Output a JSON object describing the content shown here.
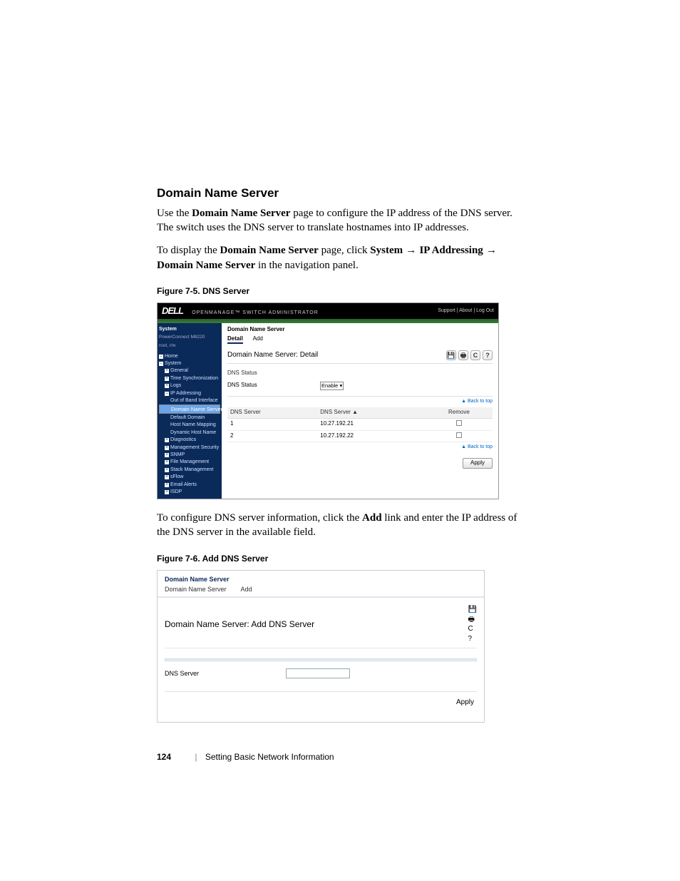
{
  "section_heading": "Domain Name Server",
  "para1_a": "Use the ",
  "para1_b_bold": "Domain Name Server",
  "para1_c": " page to configure the IP address of the DNS server. The switch uses the DNS server to translate hostnames into IP addresses.",
  "para2_a": "To display the ",
  "para2_b_bold": "Domain Name Server",
  "para2_c": " page, click ",
  "para2_d_bold": "System",
  "para2_arrow": " → ",
  "para2_e_bold": "IP Addressing",
  "para2_f_bold": "Domain Name Server",
  "para2_g": " in the navigation panel.",
  "fig75_caption": "Figure 7-5.    DNS Server",
  "fig75": {
    "logo": "DELL",
    "tagline": "OPENMANAGE™ SWITCH ADMINISTRATOR",
    "toplinks": "Support  |  About  |  Log Out",
    "nav_system": "System",
    "nav_model": "PowerConnect M8220",
    "nav_user": "root, r/w",
    "nav_items": [
      {
        "t": "Home",
        "ind": 0,
        "box": "–"
      },
      {
        "t": "System",
        "ind": 0,
        "box": "–"
      },
      {
        "t": "General",
        "ind": 1,
        "box": "+"
      },
      {
        "t": "Time Synchronization",
        "ind": 1,
        "box": "+"
      },
      {
        "t": "Logs",
        "ind": 1,
        "box": "+"
      },
      {
        "t": "IP Addressing",
        "ind": 1,
        "box": "–"
      },
      {
        "t": "Out of Band Interface",
        "ind": 2,
        "box": ""
      },
      {
        "t": "Domain Name Server",
        "ind": 2,
        "box": "",
        "sel": true
      },
      {
        "t": "Default Domain",
        "ind": 2,
        "box": ""
      },
      {
        "t": "Host Name Mapping",
        "ind": 2,
        "box": ""
      },
      {
        "t": "Dynamic Host Name",
        "ind": 2,
        "box": ""
      },
      {
        "t": "Diagnostics",
        "ind": 1,
        "box": "+"
      },
      {
        "t": "Management Security",
        "ind": 1,
        "box": "+"
      },
      {
        "t": "SNMP",
        "ind": 1,
        "box": "+"
      },
      {
        "t": "File Management",
        "ind": 1,
        "box": "+"
      },
      {
        "t": "Stack Management",
        "ind": 1,
        "box": "+"
      },
      {
        "t": "sFlow",
        "ind": 1,
        "box": "+"
      },
      {
        "t": "Email Alerts",
        "ind": 1,
        "box": "+"
      },
      {
        "t": "ISDP",
        "ind": 1,
        "box": "+"
      }
    ],
    "breadcrumb": "Domain Name Server",
    "tab_detail": "Detail",
    "tab_add": "Add",
    "panel_title": "Domain Name Server: Detail",
    "dns_status_section": "DNS Status",
    "dns_status_label": "DNS Status",
    "dns_status_value": "Enable",
    "back_to_top": "▲ Back to top",
    "table_headers": [
      "DNS Server",
      "DNS Server ▲",
      "Remove"
    ],
    "table_rows": [
      {
        "idx": "1",
        "ip": "10.27.192.21"
      },
      {
        "idx": "2",
        "ip": "10.27.192.22"
      }
    ],
    "apply": "Apply"
  },
  "para3_a": "To configure DNS server information, click the ",
  "para3_b_bold": "Add",
  "para3_c": " link and enter the IP address of the DNS server in the available field.",
  "fig76_caption": "Figure 7-6.    Add DNS Server",
  "fig76": {
    "breadcrumb": "Domain Name Server",
    "tab1": "Domain Name Server",
    "tab2": "Add",
    "panel_title": "Domain Name Server: Add DNS Server",
    "field_label": "DNS Server",
    "apply": "Apply"
  },
  "footer": {
    "page_number": "124",
    "chapter": "Setting Basic Network Information"
  }
}
